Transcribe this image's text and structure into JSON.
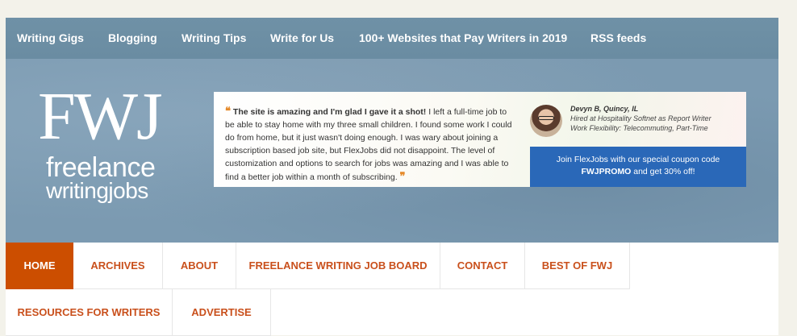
{
  "topnav": {
    "items": [
      "Writing Gigs",
      "Blogging",
      "Writing Tips",
      "Write for Us",
      "100+ Websites that Pay Writers in 2019",
      "RSS feeds"
    ]
  },
  "logo": {
    "fwj": "FWJ",
    "line1": "freelance",
    "line2": "writingjobs"
  },
  "ad": {
    "quote_bold": "The site is amazing and I'm glad I gave it a shot!",
    "quote_rest": " I left a full-time job to be able to stay home with my three small children. I found some work I could do from home, but it just wasn't doing enough. I was wary about joining a subscription based job site, but FlexJobs did not disappoint. The level of customization and options to search for jobs was amazing and I was able to find a better job within a month of subscribing.",
    "open_quote": "❝",
    "close_quote": "❞",
    "author_name": "Devyn B, Quincy, IL",
    "author_line2": "Hired at Hospitality Softnet as Report Writer",
    "author_line3": "Work Flexibility: Telecommuting, Part-Time",
    "cta_text": "Join FlexJobs with our special coupon code",
    "cta_code": "FWJPROMO",
    "cta_tail": " and get 30% off!"
  },
  "mainnav": {
    "items": [
      "HOME",
      "ARCHIVES",
      "ABOUT",
      "FREELANCE WRITING JOB BOARD",
      "CONTACT",
      "BEST OF FWJ",
      "RESOURCES FOR WRITERS",
      "ADVERTISE"
    ],
    "active": "HOME"
  },
  "colors": {
    "topnav_bg": "#6f91a6",
    "header_bg": "#7b9ab1",
    "nav_accent": "#cc4e00",
    "cta_bg": "#2a68b8"
  }
}
